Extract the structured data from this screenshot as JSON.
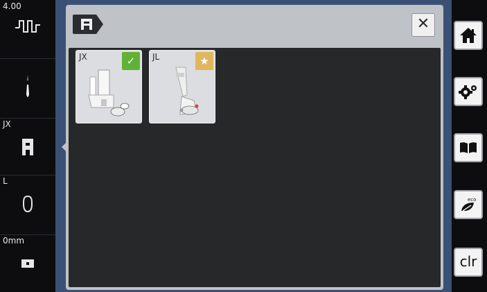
{
  "left_panel": {
    "stitch_value": "4.00",
    "presser_foot_code": "JX",
    "thread_label": "L",
    "width_value": "0mm"
  },
  "dialog": {
    "close_glyph": "✕",
    "feet": [
      {
        "code": "JX",
        "badge": "checkmark",
        "badge_glyph": "✓",
        "badge_color": "#5fb236"
      },
      {
        "code": "JL",
        "badge": "star",
        "badge_glyph": "★",
        "badge_color": "#e0b75c"
      }
    ]
  },
  "right_panel": {
    "home": "home-icon",
    "settings": "settings-icon",
    "help": "book-icon",
    "eco": "eco-icon",
    "clear_label": "clr"
  },
  "colors": {
    "accent_blue": "#3a5175",
    "dialog_gray": "#bfc2c6",
    "content_dark": "#262829",
    "check_green": "#5fb236",
    "star_yellow": "#e0b75c"
  }
}
